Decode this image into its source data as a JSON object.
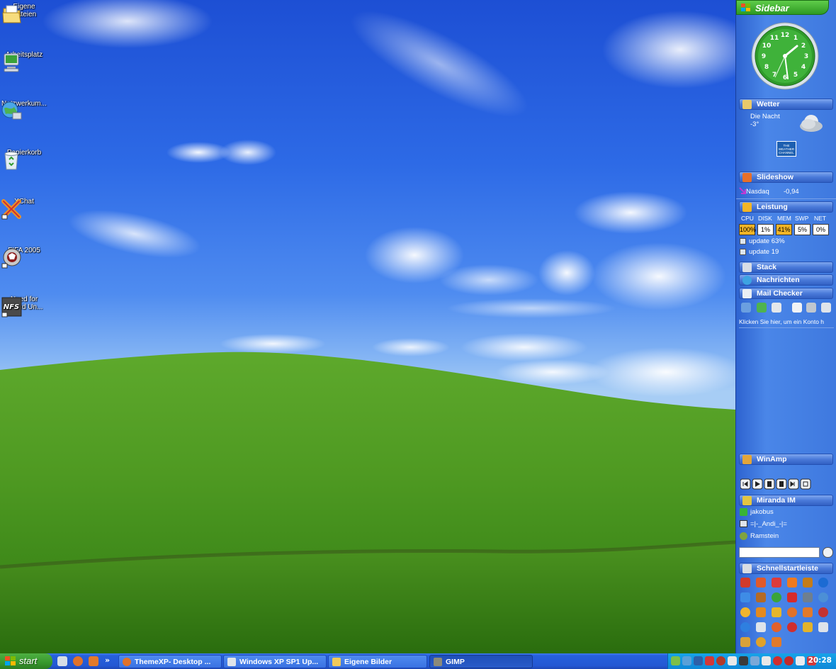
{
  "desktop_icons": [
    {
      "label": "Eigene Dateien",
      "icon": "my-documents-icon"
    },
    {
      "label": "Arbeitsplatz",
      "icon": "my-computer-icon"
    },
    {
      "label": "Netzwerkum...",
      "icon": "network-places-icon"
    },
    {
      "label": "Papierkorb",
      "icon": "recycle-bin-icon"
    },
    {
      "label": "XChat",
      "icon": "xchat-icon"
    },
    {
      "label": "FIFA 2005",
      "icon": "fifa-icon"
    },
    {
      "label": "Need for Speed Un...",
      "icon": "need-for-speed-icon"
    }
  ],
  "sidebar": {
    "title": "Sidebar",
    "clock": {
      "numbers": [
        "12",
        "1",
        "2",
        "3",
        "4",
        "5",
        "6",
        "7",
        "8",
        "9",
        "10",
        "11"
      ]
    },
    "weather": {
      "header": "Wetter",
      "line1": "Die Nacht",
      "line2": "-3°",
      "logo_text": "THE WEATHER CHANNEL"
    },
    "slideshow": {
      "header": "Slideshow"
    },
    "stock": {
      "name": "Nasdaq",
      "value": "-0,94"
    },
    "performance": {
      "header": "Leistung",
      "labels": [
        "CPU",
        "DISK",
        "MEM",
        "SWP",
        "NET"
      ],
      "values": [
        "100%",
        "1%",
        "41%",
        "5%",
        "0%"
      ],
      "line1": "update 63%",
      "line2": "update 19"
    },
    "stack": {
      "header": "Stack"
    },
    "news": {
      "header": "Nachrichten"
    },
    "mail": {
      "header": "Mail Checker",
      "hint": "Klicken Sie hier, um ein Konto h"
    },
    "winamp": {
      "header": "WinAmp"
    },
    "miranda": {
      "header": "Miranda IM",
      "contacts": [
        "jakobus",
        "=|-_Andi_-|=",
        "Ramstein"
      ]
    },
    "quicklaunch": {
      "header": "Schnellstartleiste"
    }
  },
  "taskbar": {
    "start_label": "start",
    "chevron": "»",
    "buttons": [
      {
        "label": "ThemeXP- Desktop ..."
      },
      {
        "label": "Windows XP SP1 Up..."
      },
      {
        "label": "Eigene Bilder"
      },
      {
        "label": "GIMP"
      }
    ],
    "clock": "20:28"
  }
}
